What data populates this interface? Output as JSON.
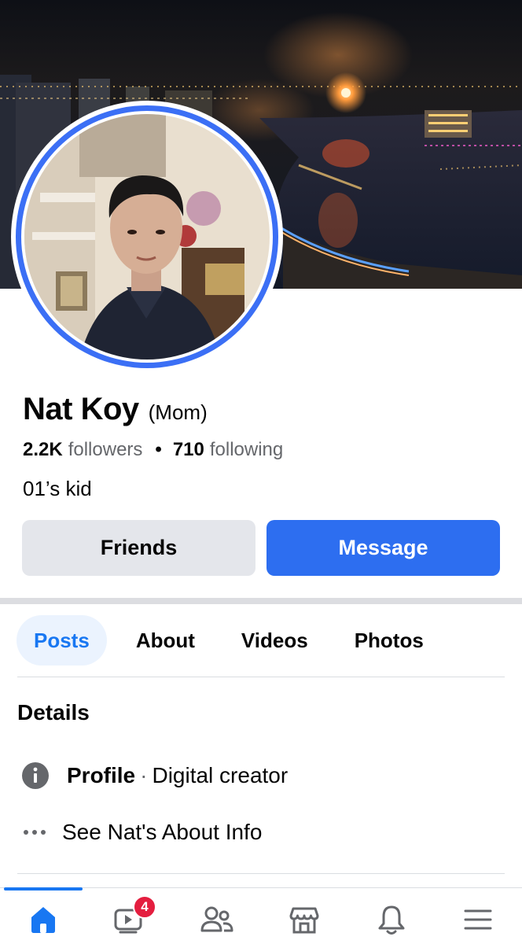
{
  "profile": {
    "name": "Nat Koy",
    "alternate_name": "(Mom)",
    "followers_count": "2.2K",
    "followers_label": "followers",
    "following_count": "710",
    "following_label": "following",
    "bio": "01’s kid"
  },
  "actions": {
    "friends_label": "Friends",
    "message_label": "Message"
  },
  "tabs": [
    {
      "label": "Posts",
      "active": true
    },
    {
      "label": "About",
      "active": false
    },
    {
      "label": "Videos",
      "active": false
    },
    {
      "label": "Photos",
      "active": false
    }
  ],
  "details": {
    "title": "Details",
    "profile_label": "Profile",
    "profile_separator": "·",
    "profile_category": "Digital creator",
    "see_about": "See Nat's About Info"
  },
  "bottom_nav": {
    "items": [
      {
        "icon": "home-icon",
        "active": true
      },
      {
        "icon": "video-icon",
        "badge": "4"
      },
      {
        "icon": "friends-icon"
      },
      {
        "icon": "marketplace-icon"
      },
      {
        "icon": "bell-icon"
      },
      {
        "icon": "menu-icon"
      }
    ]
  },
  "colors": {
    "accent": "#1877f2",
    "message_button": "#2d6ef0",
    "badge": "#e41e3f",
    "avatar_ring": "#3b6ff5"
  }
}
